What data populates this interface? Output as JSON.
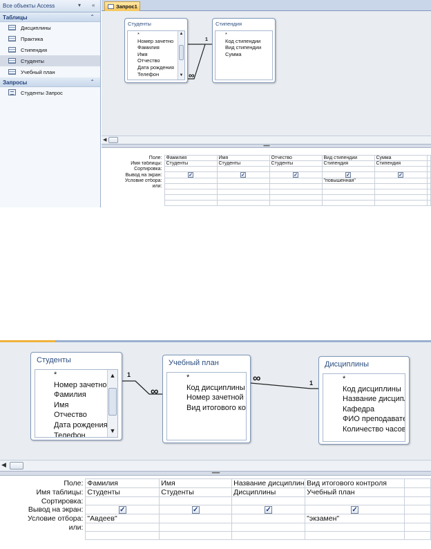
{
  "top": {
    "nav": {
      "header": "Все объекты Access",
      "header_menu": "▾",
      "header_collapse": "«",
      "groups": [
        {
          "title": "Таблицы",
          "chevron": "⌃",
          "items": [
            "Дисциплины",
            "Практика",
            "Стипендия",
            "Студенты",
            "Учебный план"
          ]
        },
        {
          "title": "Запросы",
          "chevron": "⌃",
          "items": [
            "Студенты Запрос"
          ]
        }
      ]
    },
    "tab": "Запрос1",
    "tables": {
      "students": {
        "title": "Студенты",
        "fields": [
          "*",
          "Номер зачетно",
          "Фамилия",
          "Имя",
          "Отчество",
          "Дата рождения",
          "Телефон"
        ]
      },
      "stipend": {
        "title": "Стипендия",
        "fields": [
          "*",
          "Код стипендии",
          "Вид стипендии",
          "Сумма"
        ]
      }
    },
    "relation": {
      "one": "1",
      "many": "∞"
    },
    "grid": {
      "row_labels": [
        "Поле:",
        "Имя таблицы:",
        "Сортировка:",
        "Вывод на экран:",
        "Условие отбора:",
        "или:"
      ],
      "columns": [
        {
          "field": "Фамилия",
          "table": "Студенты",
          "sort": "",
          "show": true,
          "criteria": "",
          "or": ""
        },
        {
          "field": "Имя",
          "table": "Студенты",
          "sort": "",
          "show": true,
          "criteria": "",
          "or": ""
        },
        {
          "field": "Отчество",
          "table": "Студенты",
          "sort": "",
          "show": true,
          "criteria": "",
          "or": ""
        },
        {
          "field": "Вид стипендии",
          "table": "Стипендия",
          "sort": "",
          "show": true,
          "criteria": "\"повышенная\"",
          "or": ""
        },
        {
          "field": "Сумма",
          "table": "Стипендия",
          "sort": "",
          "show": true,
          "criteria": "",
          "or": ""
        }
      ]
    }
  },
  "bottom": {
    "tables": {
      "students": {
        "title": "Студенты",
        "fields": [
          "*",
          "Номер зачетно",
          "Фамилия",
          "Имя",
          "Отчество",
          "Дата рождения",
          "Телефон"
        ]
      },
      "plan": {
        "title": "Учебный план",
        "fields": [
          "*",
          "Код дисциплины",
          "Номер зачетной к",
          "Вид итогового кон"
        ]
      },
      "disciplines": {
        "title": "Дисциплины",
        "fields": [
          "*",
          "Код дисциплины",
          "Название дисципл",
          "Кафедра",
          "ФИО преподавате",
          "Количество часов"
        ]
      }
    },
    "relations": [
      {
        "one": "1",
        "many": "∞"
      },
      {
        "one": "1",
        "many": "∞"
      }
    ],
    "grid": {
      "row_labels": [
        "Поле:",
        "Имя таблицы:",
        "Сортировка:",
        "Вывод на экран:",
        "Условие отбора:",
        "или:"
      ],
      "columns": [
        {
          "field": "Фамилия",
          "table": "Студенты",
          "sort": "",
          "show": true,
          "criteria": "\"Авдеев\"",
          "or": ""
        },
        {
          "field": "Имя",
          "table": "Студенты",
          "sort": "",
          "show": true,
          "criteria": "",
          "or": ""
        },
        {
          "field": "Название дисциплин",
          "table": "Дисциплины",
          "sort": "",
          "show": true,
          "criteria": "",
          "or": ""
        },
        {
          "field": "Вид итогового контроля",
          "table": "Учебный план",
          "sort": "",
          "show": true,
          "criteria": "\"экзамен\"",
          "or": ""
        }
      ]
    }
  },
  "colors": {
    "nav_bg": "#f4f7fb",
    "nav_selected": "#d3dae6",
    "tab_active": "#f7c55a",
    "designer_bg": "#e9edf2",
    "table_title": "#2c4d7e",
    "key_icon": "#d9a600"
  }
}
